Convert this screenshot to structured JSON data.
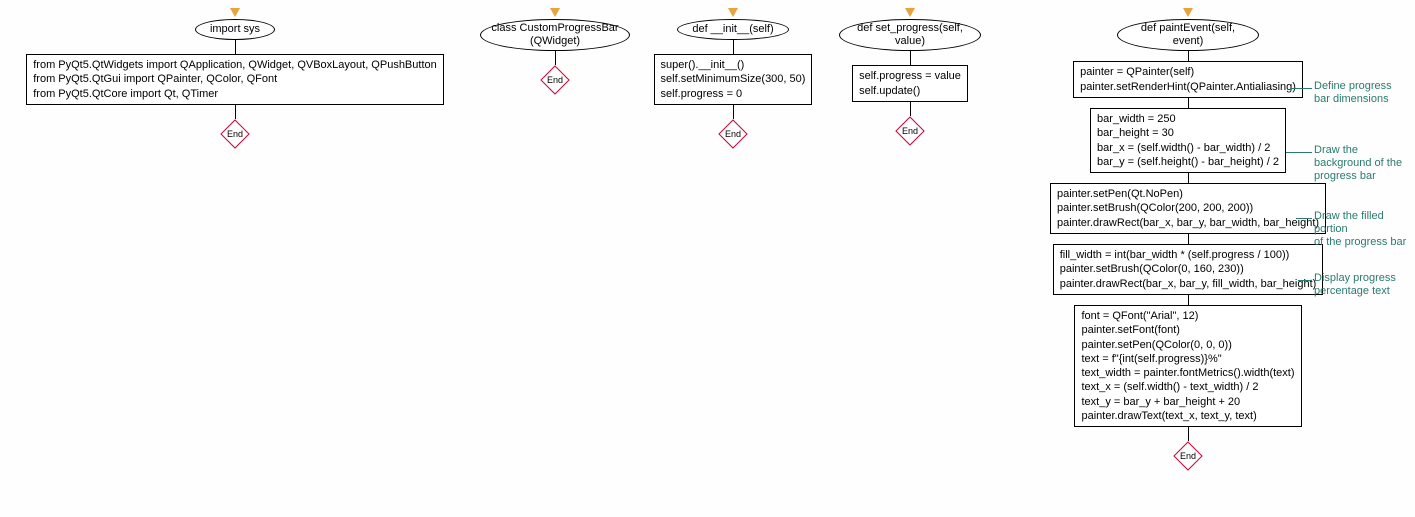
{
  "col1": {
    "head": "import sys",
    "box": "from PyQt5.QtWidgets import QApplication, QWidget, QVBoxLayout, QPushButton\nfrom PyQt5.QtGui import QPainter, QColor, QFont\nfrom PyQt5.QtCore import Qt, QTimer",
    "end": "End"
  },
  "col2": {
    "head": "class CustomProgressBar\n(QWidget)",
    "end": "End"
  },
  "col3": {
    "head": "def __init__(self)",
    "box": "super().__init__()\nself.setMinimumSize(300, 50)\nself.progress = 0",
    "end": "End"
  },
  "col4": {
    "head": "def set_progress(self,\nvalue)",
    "box": "self.progress = value\nself.update()",
    "end": "End"
  },
  "col5": {
    "head": "def paintEvent(self,\nevent)",
    "box1": "painter = QPainter(self)\npainter.setRenderHint(QPainter.Antialiasing)",
    "comment1": "Define progress\nbar dimensions",
    "box2": "bar_width = 250\nbar_height = 30\nbar_x = (self.width() - bar_width) / 2\nbar_y = (self.height() - bar_height) / 2",
    "comment2": "Draw the background of the\nprogress bar",
    "box3": "painter.setPen(Qt.NoPen)\npainter.setBrush(QColor(200, 200, 200))\npainter.drawRect(bar_x, bar_y, bar_width, bar_height)",
    "comment3": "Draw the filled portion\nof the progress bar",
    "box4": "fill_width = int(bar_width * (self.progress / 100))\npainter.setBrush(QColor(0, 160, 230))\npainter.drawRect(bar_x, bar_y, fill_width, bar_height)",
    "comment4": "Display progress\npercentage text",
    "box5": "font = QFont(\"Arial\", 12)\npainter.setFont(font)\npainter.setPen(QColor(0, 0, 0))\ntext = f\"{int(self.progress)}%\"\ntext_width = painter.fontMetrics().width(text)\ntext_x = (self.width() - text_width) / 2\ntext_y = bar_y + bar_height + 20\npainter.drawText(text_x, text_y, text)",
    "end": "End"
  }
}
